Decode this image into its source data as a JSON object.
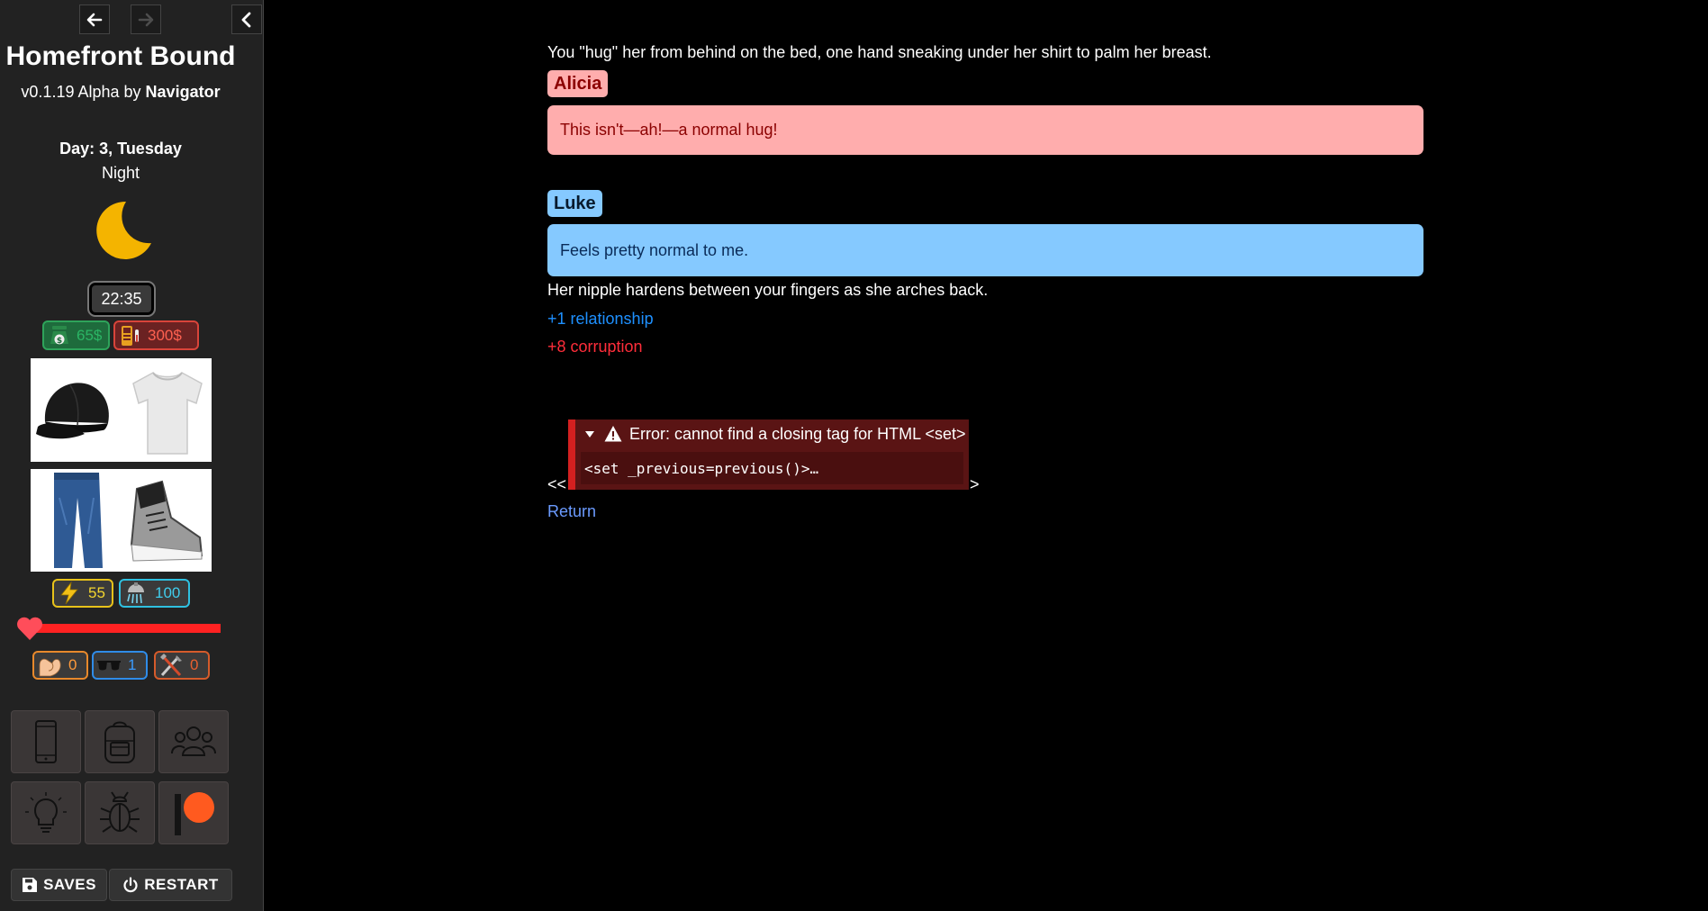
{
  "story": {
    "title": "Homefront Bound",
    "version": "v0.1.19 Alpha by",
    "author": "Navigator"
  },
  "time": {
    "day": "Day: 3, Tuesday",
    "period": "Night",
    "clock": "22:35"
  },
  "money": {
    "cash": "65$",
    "debt": "300$"
  },
  "stats": {
    "energy": "55",
    "hygiene": "100",
    "health_fraction": 1.0
  },
  "skills": {
    "strength": "0",
    "charm": "1",
    "crafting": "0"
  },
  "outfit": {
    "items": [
      "cap-icon",
      "tshirt-icon",
      "jeans-icon",
      "sneakers-icon"
    ]
  },
  "menu": {
    "tiles": [
      "phone-icon",
      "backpack-icon",
      "people-icon",
      "lightbulb-icon",
      "bug-icon",
      "patreon-icon"
    ]
  },
  "buttons": {
    "saves": "SAVES",
    "restart": "RESTART"
  },
  "passage": {
    "intro": "You \"hug\" her from behind on the bed, one hand sneaking under her shirt to palm her breast.",
    "alicia_name": "Alicia",
    "alicia_line": "This isn't—ah!—a normal hug!",
    "luke_name": "Luke",
    "luke_line": "Feels pretty normal to me.",
    "narration": "Her nipple hardens between your fingers as she arches back.",
    "relationship": "+1 relationship",
    "corruption": "+8 corruption",
    "open_marker": "<<",
    "close_marker": ">",
    "error_title": "Error: cannot find a closing tag for HTML <set>",
    "error_code": "<set _previous=previous()>…",
    "return_link": "Return"
  },
  "colors": {
    "alicia": "#ffadad",
    "luke": "#85c9ff",
    "relationship": "#1e90ff",
    "corruption": "#ff2d3a",
    "link": "#6b9bff"
  }
}
